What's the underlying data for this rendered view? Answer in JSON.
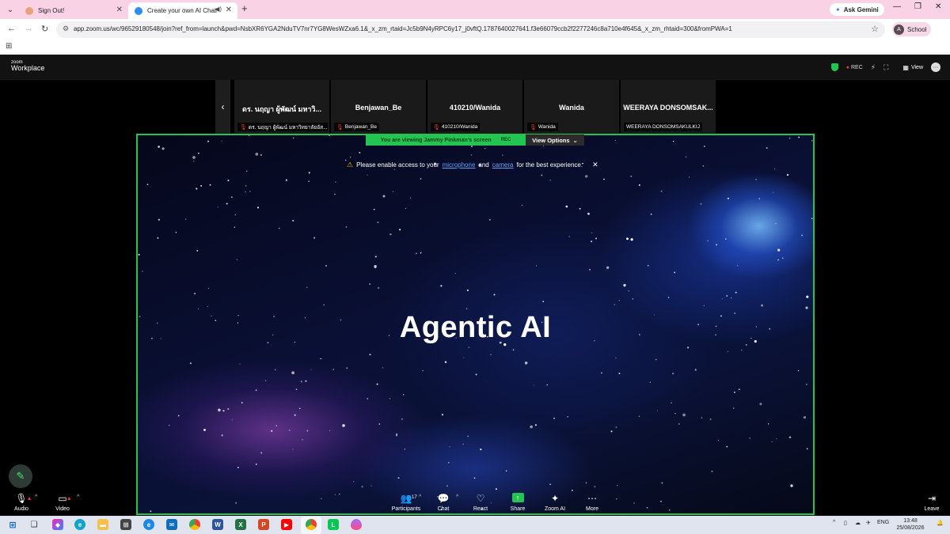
{
  "browser": {
    "tabs": [
      {
        "title": "Sign Out!",
        "active": false
      },
      {
        "title": "Create your own AI Chatbot",
        "active": true
      }
    ],
    "ask_gemini": "Ask Gemini",
    "url": "app.zoom.us/wc/96529180548/join?ref_from=launch&pwd=NsbXR6YGA2NduTV7nr7YG8WesWZxa6.1&_x_zm_rtaid=Jc5b9N4yRPC6y17_j0vftQ.1787640027641.f3e66079ccb2f2277246c8a710e4f645&_x_zm_rhtaid=300&fromPWA=1",
    "profile_initial": "A",
    "profile_label": "School"
  },
  "zoom": {
    "logo_small": "zoom",
    "logo_big": "Workplace",
    "rec_label": "REC",
    "view_label": "View",
    "participants_tiles": [
      {
        "name": "ดร. นฤญา ผู้พัฒน์ มหาวิ...",
        "label": "ดร. นฤญา ผู้พัฒน์ มหาวิทยาลัยอัส..."
      },
      {
        "name": "Benjawan_Be",
        "label": "Benjawan_Be"
      },
      {
        "name": "410210/Wanida",
        "label": "410210/Wanida"
      },
      {
        "name": "Wanida",
        "label": "Wanida"
      },
      {
        "name": "WEERAYA DONSOMSAK...",
        "label": "WEERAYA DONSOMSAKULKIJ"
      }
    ],
    "viewing_text": "You are viewing  Jammy Pinkman's screen",
    "viewing_rec": "REC",
    "view_options": "View Options",
    "notice": {
      "prefix": "Please enable access to your",
      "microphone": "microphone",
      "and": "and",
      "camera": "camera",
      "suffix": "for the best experience."
    },
    "shared_title": "Agentic AI",
    "toolbar": {
      "audio": "Audio",
      "video": "Video",
      "participants": "Participants",
      "participants_count": "17",
      "chat": "Chat",
      "react": "React",
      "share": "Share",
      "zoom_ai": "Zoom AI",
      "more": "More",
      "leave": "Leave"
    }
  },
  "taskbar": {
    "lang": "ENG",
    "time": "13:48",
    "date": "25/08/2026"
  },
  "colors": {
    "accent_green": "#23c552",
    "tab_strip_pink": "#f9d3e5",
    "mic_off_red": "#e53935"
  }
}
